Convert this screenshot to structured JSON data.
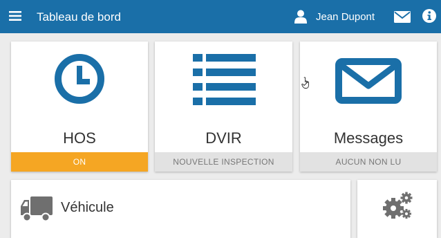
{
  "header": {
    "title": "Tableau de bord",
    "user_name": "Jean Dupont",
    "icons": [
      "menu-icon",
      "user-icon",
      "envelope-icon",
      "info-icon"
    ],
    "bar_color": "#1a6fa8"
  },
  "tiles": {
    "hos": {
      "label": "HOS",
      "status": "ON",
      "icon": "clock-icon",
      "status_color": "#f5a623"
    },
    "dvir": {
      "label": "DVIR",
      "status": "NOUVELLE INSPECTION",
      "icon": "list-icon"
    },
    "messages": {
      "label": "Messages",
      "status": "AUCUN NON LU",
      "icon": "envelope-icon"
    },
    "vehicle": {
      "label": "Véhicule",
      "icon": "truck-icon"
    },
    "settings": {
      "icon": "gears-icon"
    }
  },
  "colors": {
    "accent": "#1a6fa8",
    "icon_grey": "#6f6f6f"
  }
}
